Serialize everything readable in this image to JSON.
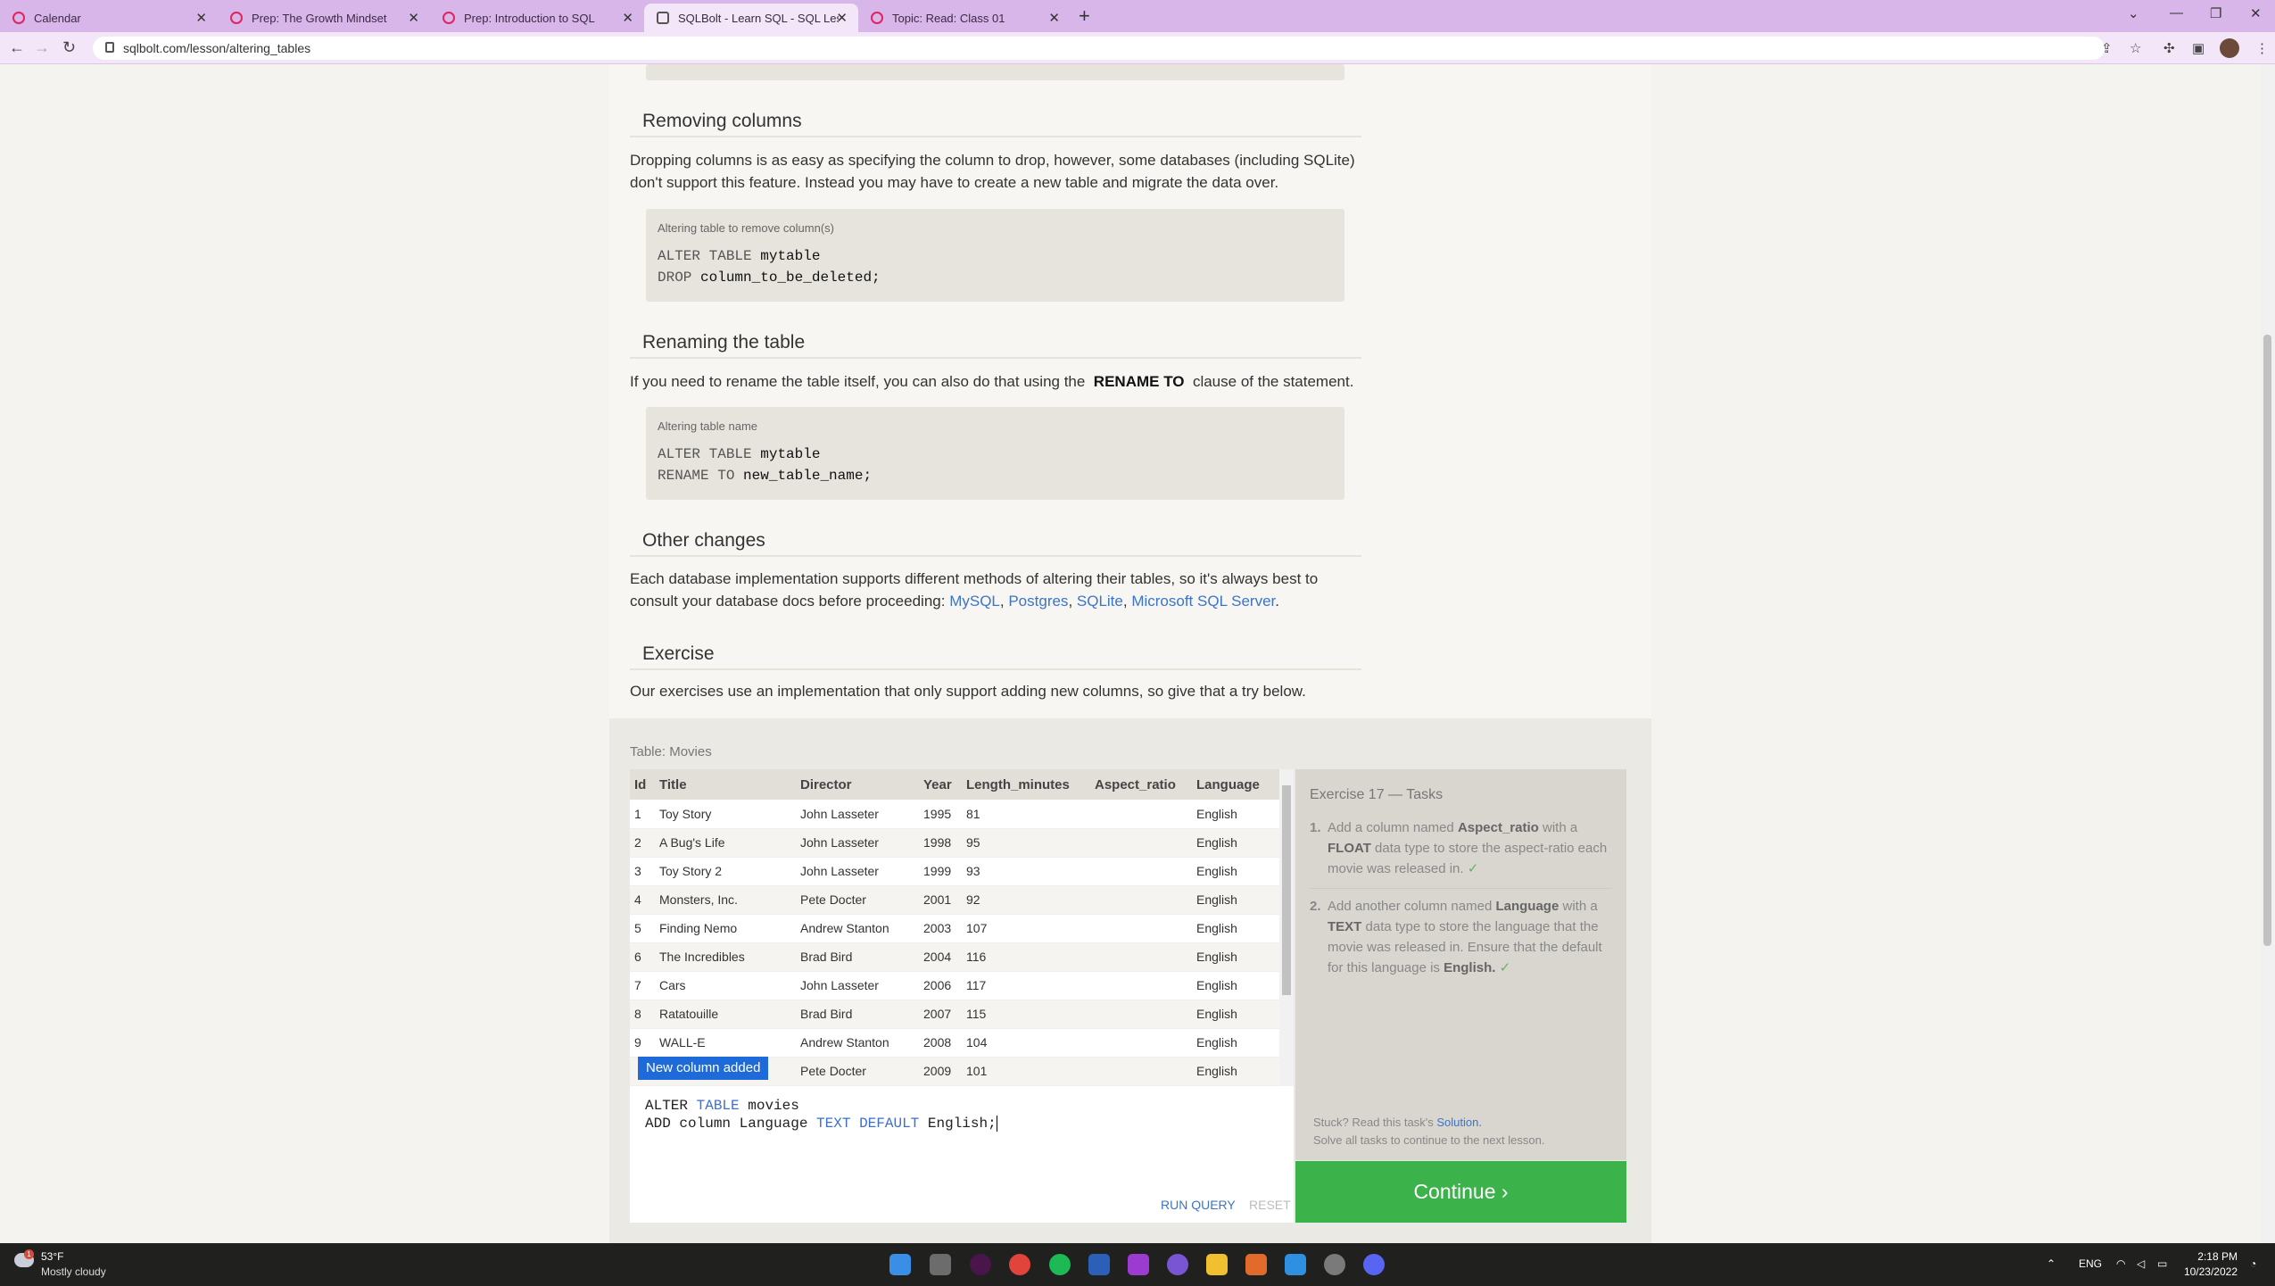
{
  "browser": {
    "tabs": [
      {
        "label": "Calendar"
      },
      {
        "label": "Prep: The Growth Mindset"
      },
      {
        "label": "Prep: Introduction to SQL"
      },
      {
        "label": "SQLBolt - Learn SQL - SQL Lesson"
      },
      {
        "label": "Topic: Read: Class 01"
      }
    ],
    "new_tab": "+",
    "url": "sqlbolt.com/lesson/altering_tables"
  },
  "lesson": {
    "removing": {
      "title": "Removing columns",
      "text": "Dropping columns is as easy as specifying the column to drop, however, some databases (including SQLite) don't support this feature. Instead you may have to create a new table and migrate the data over.",
      "code_caption": "Altering table to remove column(s)",
      "code_line1_kw": "ALTER TABLE",
      "code_line1_val": "mytable",
      "code_line2_kw": "DROP",
      "code_line2_val": "column_to_be_deleted;"
    },
    "renaming": {
      "title": "Renaming the table",
      "text_before": "If you need to rename the table itself, you can also do that using the",
      "text_bold": "RENAME TO",
      "text_after": "clause of the statement.",
      "code_caption": "Altering table name",
      "code_line1_kw": "ALTER TABLE",
      "code_line1_val": "mytable",
      "code_line2_kw": "RENAME TO",
      "code_line2_val": "new_table_name;"
    },
    "other": {
      "title": "Other changes",
      "text": "Each database implementation supports different methods of altering their tables, so it's always best to consult your database docs before proceeding:",
      "links": [
        "MySQL",
        "Postgres",
        "SQLite",
        "Microsoft SQL Server"
      ]
    },
    "exercise": {
      "title": "Exercise",
      "text": "Our exercises use an implementation that only support adding new columns, so give that a try below."
    }
  },
  "table": {
    "name": "Table: Movies",
    "columns": [
      "Id",
      "Title",
      "Director",
      "Year",
      "Length_minutes",
      "Aspect_ratio",
      "Language"
    ],
    "rows": [
      [
        "1",
        "Toy Story",
        "John Lasseter",
        "1995",
        "81",
        "",
        "English"
      ],
      [
        "2",
        "A Bug's Life",
        "John Lasseter",
        "1998",
        "95",
        "",
        "English"
      ],
      [
        "3",
        "Toy Story 2",
        "John Lasseter",
        "1999",
        "93",
        "",
        "English"
      ],
      [
        "4",
        "Monsters, Inc.",
        "Pete Docter",
        "2001",
        "92",
        "",
        "English"
      ],
      [
        "5",
        "Finding Nemo",
        "Andrew Stanton",
        "2003",
        "107",
        "",
        "English"
      ],
      [
        "6",
        "The Incredibles",
        "Brad Bird",
        "2004",
        "116",
        "",
        "English"
      ],
      [
        "7",
        "Cars",
        "John Lasseter",
        "2006",
        "117",
        "",
        "English"
      ],
      [
        "8",
        "Ratatouille",
        "Brad Bird",
        "2007",
        "115",
        "",
        "English"
      ],
      [
        "9",
        "WALL-E",
        "Andrew Stanton",
        "2008",
        "104",
        "",
        "English"
      ],
      [
        "",
        "",
        "Pete Docter",
        "2009",
        "101",
        "",
        "English"
      ]
    ],
    "badge": "New column added"
  },
  "editor": {
    "line1": {
      "kw1": "ALTER",
      "kw2": "TABLE",
      "rest": "movies"
    },
    "line2": {
      "a": "ADD column Language",
      "kw1": "TEXT",
      "kw2": "DEFAULT",
      "rest": "English;"
    },
    "run_label": "RUN QUERY",
    "reset_label": "RESET"
  },
  "tasks": {
    "title": "Exercise 17 — Tasks",
    "items": [
      {
        "num": "1.",
        "pre": "Add a column named",
        "b1": "Aspect_ratio",
        "mid": "with a",
        "b2": "FLOAT",
        "post": "data type to store the aspect-ratio each movie was released in."
      },
      {
        "num": "2.",
        "pre": "Add another column named",
        "b1": "Language",
        "mid": "with a",
        "b2": "TEXT",
        "post": "data type to store the language that the movie was released in. Ensure that the default for this language is",
        "b3": "English."
      }
    ],
    "check": "✓",
    "stuck_text": "Stuck? Read this task's",
    "solution_label": "Solution.",
    "solve_text": "Solve all tasks to continue to the next lesson.",
    "continue_label": "Continue ›"
  },
  "taskbar": {
    "temp": "53°F",
    "condition": "Mostly cloudy",
    "weather_badge": "1",
    "lang": "ENG",
    "time": "2:18 PM",
    "date": "10/23/2022"
  },
  "colors": {
    "accent": "#3cb24a",
    "link": "#3c74c9",
    "badge": "#1e6ad8",
    "tabbar": "#d9b6ea"
  }
}
